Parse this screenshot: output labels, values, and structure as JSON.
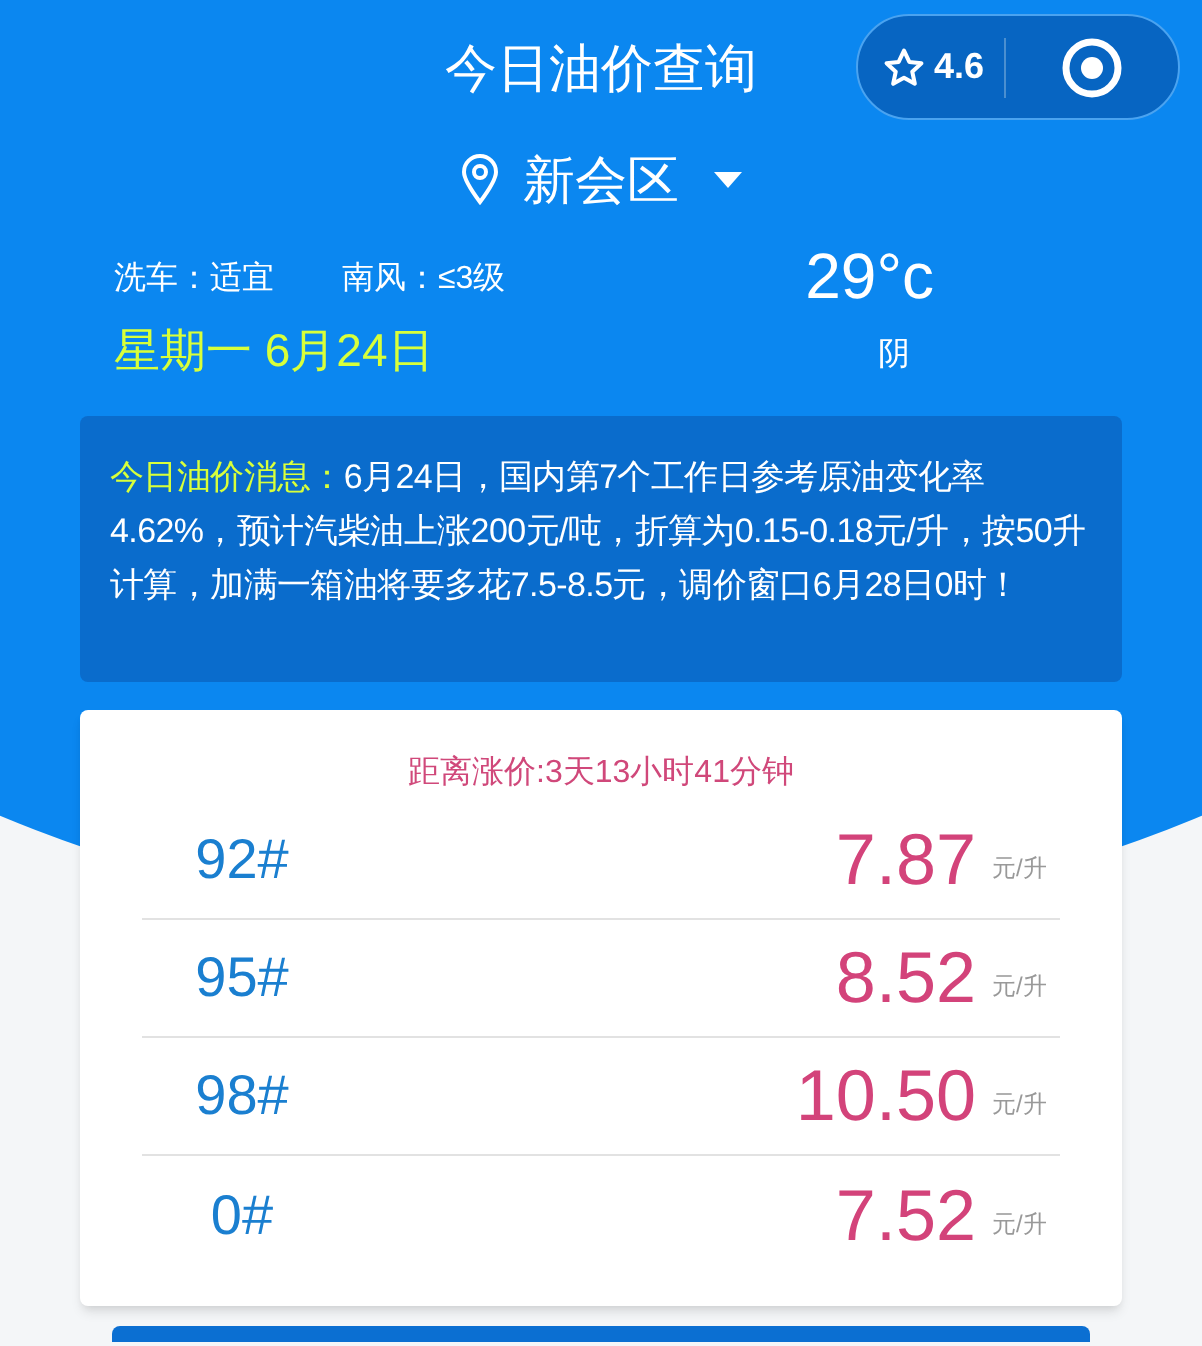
{
  "header": {
    "title": "今日油价查询",
    "rating": "4.6"
  },
  "location": {
    "name": "新会区"
  },
  "weather": {
    "car_wash": "洗车：适宜",
    "wind": "南风：≤3级",
    "temperature": "29°c",
    "condition": "阴"
  },
  "date": "星期一 6月24日",
  "notice": {
    "label": "今日油价消息：",
    "text": "6月24日，国内第7个工作日参考原油变化率4.62%，预计汽柴油上涨200元/吨，折算为0.15-0.18元/升，按50升计算，加满一箱油将要多花7.5-8.5元，调价窗口6月28日0时！"
  },
  "countdown": "距离涨价:3天13小时41分钟",
  "prices": [
    {
      "grade": "92#",
      "price": "7.87",
      "unit": "元/升"
    },
    {
      "grade": "95#",
      "price": "8.52",
      "unit": "元/升"
    },
    {
      "grade": "98#",
      "price": "10.50",
      "unit": "元/升"
    },
    {
      "grade": "0#",
      "price": "7.52",
      "unit": "元/升"
    }
  ]
}
